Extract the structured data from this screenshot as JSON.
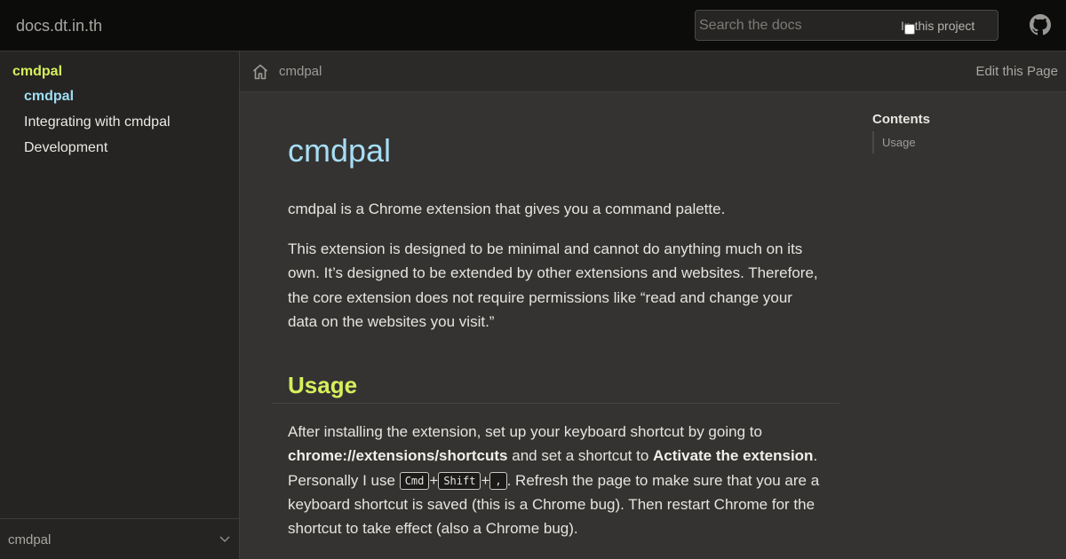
{
  "header": {
    "site_title": "docs.dt.in.th",
    "search_placeholder": "Search the docs",
    "scope_label": "In this project",
    "github_icon": "github-icon"
  },
  "sidebar": {
    "root": "cmdpal",
    "items": [
      {
        "label": "cmdpal",
        "active": true
      },
      {
        "label": "Integrating with cmdpal",
        "active": false
      },
      {
        "label": "Development",
        "active": false
      }
    ],
    "footer_label": "cmdpal"
  },
  "breadcrumb": {
    "home_icon": "home-icon",
    "current": "cmdpal",
    "edit_label": "Edit this Page"
  },
  "toc": {
    "title": "Contents",
    "items": [
      "Usage"
    ]
  },
  "article": {
    "title": "cmdpal",
    "intro": "cmdpal is a Chrome extension that gives you a command palette.",
    "para2": "This extension is designed to be minimal and cannot do anything much on its own. It’s designed to be extended by other extensions and websites. Therefore, the core extension does not require permissions like “read and change your data on the websites you visit.”",
    "usage_heading": "Usage",
    "usage": {
      "t1": "After installing the extension, set up your keyboard shortcut by going to ",
      "b1": "chrome://extensions/shortcuts",
      "t2": " and set a shortcut to ",
      "b2": "Activate the extension",
      "t3": ". Personally I use ",
      "k1": "Cmd",
      "plus1": "+",
      "k2": "Shift",
      "plus2": "+",
      "k3": ",",
      "t4": ". Refresh the page to make sure that you are a keyboard shortcut is saved (this is a Chrome bug). Then restart Chrome for the shortcut to take effect (also a Chrome bug)."
    }
  },
  "colors": {
    "title_blue": "#a6def5",
    "accent_lime": "#d6ef5c",
    "background": "#343331"
  }
}
